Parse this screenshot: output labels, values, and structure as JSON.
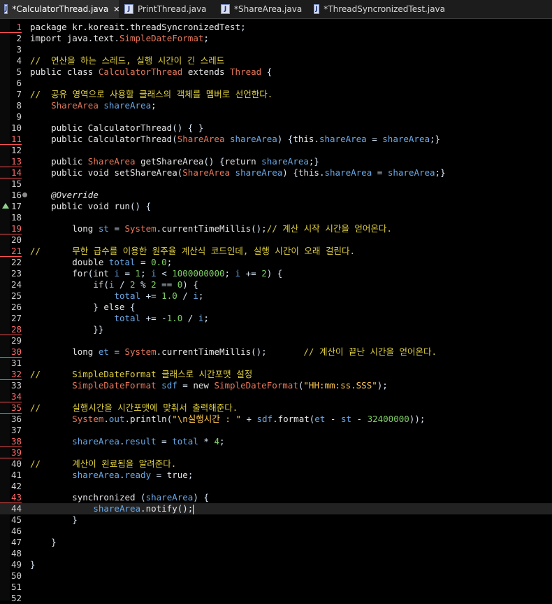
{
  "tabs": [
    {
      "label": "*CalculatorThread.java",
      "active": true,
      "closable": true
    },
    {
      "label": "PrintThread.java",
      "active": false
    },
    {
      "label": "*ShareArea.java",
      "active": false
    },
    {
      "label": "*ThreadSyncronizedTest.java",
      "active": false
    }
  ],
  "lines": [
    {
      "n": "1",
      "t": "package kr.koreait.threadSyncronizedTest;"
    },
    {
      "n": "2",
      "t": "import java.text.SimpleDateFormat;"
    },
    {
      "n": "3",
      "t": ""
    },
    {
      "n": "4",
      "t": "//  연산을 하는 스레드, 실행 시간이 긴 스레드"
    },
    {
      "n": "5",
      "t": "public class CalculatorThread extends Thread {"
    },
    {
      "n": "6",
      "t": ""
    },
    {
      "n": "7",
      "t": "//  공유 영역으로 사용할 클래스의 객체를 멤버로 선언한다."
    },
    {
      "n": "8",
      "t": "    ShareArea shareArea;"
    },
    {
      "n": "9",
      "t": ""
    },
    {
      "n": "10",
      "t": "    public CalculatorThread() { }"
    },
    {
      "n": "11",
      "t": "    public CalculatorThread(ShareArea shareArea) {this.shareArea = shareArea;}"
    },
    {
      "n": "12",
      "t": ""
    },
    {
      "n": "13",
      "t": "    public ShareArea getShareArea() {return shareArea;}"
    },
    {
      "n": "14",
      "t": "    public void setShareArea(ShareArea shareArea) {this.shareArea = shareArea;}"
    },
    {
      "n": "15",
      "t": ""
    },
    {
      "n": "16",
      "t": "    @Override"
    },
    {
      "n": "17",
      "t": "    public void run() {"
    },
    {
      "n": "18",
      "t": ""
    },
    {
      "n": "19",
      "t": "        long st = System.currentTimeMillis();// 계산 시작 시간을 얻어온다."
    },
    {
      "n": "20",
      "t": ""
    },
    {
      "n": "21",
      "t": "//      무한 급수를 이용한 원주율 계산식 코드인데, 실행 시간이 오래 걸린다."
    },
    {
      "n": "22",
      "t": "        double total = 0.0;"
    },
    {
      "n": "23",
      "t": "        for(int i = 1; i < 1000000000; i += 2) {"
    },
    {
      "n": "24",
      "t": "            if(i / 2 % 2 == 0) {"
    },
    {
      "n": "25",
      "t": "                total += 1.0 / i;"
    },
    {
      "n": "26",
      "t": "            } else {"
    },
    {
      "n": "27",
      "t": "                total += -1.0 / i;"
    },
    {
      "n": "28",
      "t": "            }}"
    },
    {
      "n": "29",
      "t": ""
    },
    {
      "n": "30",
      "t": "        long et = System.currentTimeMillis();       // 계산이 끝난 시간을 얻어온다."
    },
    {
      "n": "31",
      "t": ""
    },
    {
      "n": "32",
      "t": "//      SimpleDateFormat 클래스로 시간포맷 설정"
    },
    {
      "n": "33",
      "t": "        SimpleDateFormat sdf = new SimpleDateFormat(\"HH:mm:ss.SSS\");"
    },
    {
      "n": "34",
      "t": ""
    },
    {
      "n": "35",
      "t": "//      실행시간을 시간포맷에 맞춰서 출력해준다."
    },
    {
      "n": "36",
      "t": "        System.out.println(\"\\n실행시간 : \" + sdf.format(et - st - 32400000));"
    },
    {
      "n": "37",
      "t": ""
    },
    {
      "n": "38",
      "t": "        shareArea.result = total * 4;"
    },
    {
      "n": "39",
      "t": ""
    },
    {
      "n": "40",
      "t": "//      계산이 왼료됨을 알려준다."
    },
    {
      "n": "41",
      "t": "        shareArea.ready = true;"
    },
    {
      "n": "42",
      "t": ""
    },
    {
      "n": "43",
      "t": "        synchronized (shareArea) {"
    },
    {
      "n": "44",
      "t": "            shareArea.notify();"
    },
    {
      "n": "45",
      "t": "        }"
    },
    {
      "n": "46",
      "t": ""
    },
    {
      "n": "47",
      "t": "    }"
    },
    {
      "n": "48",
      "t": ""
    },
    {
      "n": "49",
      "t": "}"
    },
    {
      "n": "50",
      "t": ""
    },
    {
      "n": "51",
      "t": ""
    },
    {
      "n": "52",
      "t": ""
    }
  ]
}
